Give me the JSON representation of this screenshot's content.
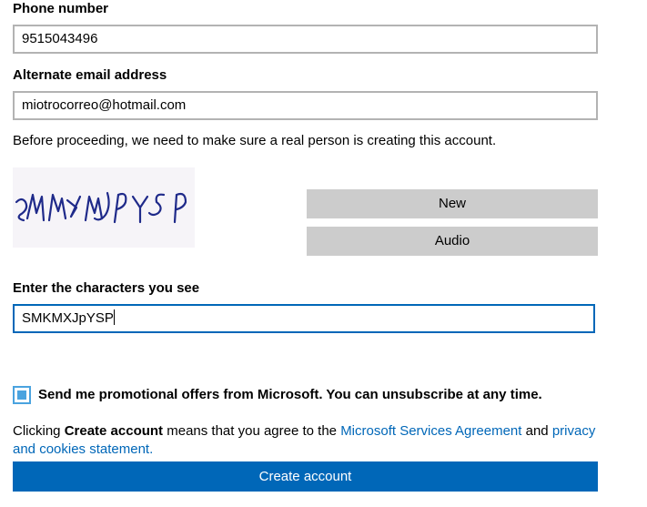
{
  "phone": {
    "label": "Phone number",
    "value": "9515043496"
  },
  "alt_email": {
    "label": "Alternate email address",
    "value": "miotrocorreo@hotmail.com"
  },
  "captcha": {
    "intro": "Before proceeding, we need to make sure a real person is creating this account.",
    "image_text": "SMKMXJPYSP",
    "new_label": "New",
    "audio_label": "Audio",
    "input_label": "Enter the characters you see",
    "input_value": "SMKMXJpYSP"
  },
  "promo": {
    "checked": true,
    "label": "Send me promotional offers from Microsoft. You can unsubscribe at any time."
  },
  "agreement": {
    "prefix": "Clicking ",
    "bold": "Create account",
    "middle": " means that you agree to the ",
    "link1": "Microsoft Services Agreement",
    "and": " and ",
    "link2": "privacy and cookies statement."
  },
  "submit_label": "Create account",
  "colors": {
    "accent": "#0067b8",
    "gray_button": "#cccccc",
    "field_border": "#b3b3b3",
    "checkbox": "#4aa3df"
  }
}
